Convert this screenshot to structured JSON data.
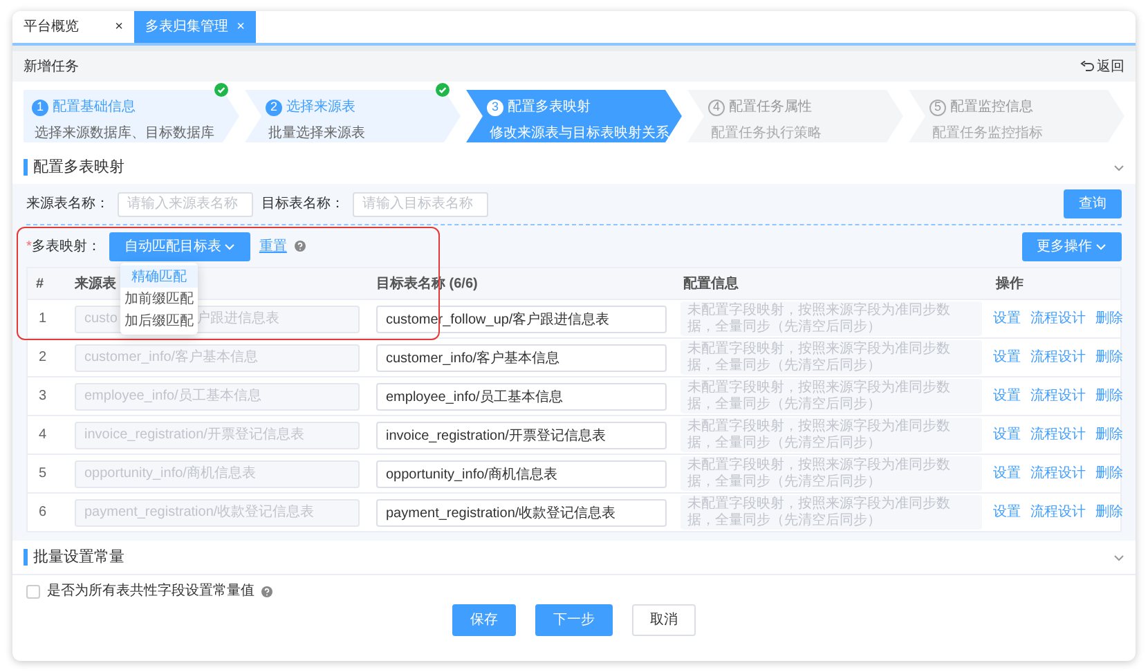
{
  "tabs": [
    {
      "label": "平台概览",
      "close": "×",
      "selected": false
    },
    {
      "label": "多表归集管理",
      "close": "×",
      "selected": true
    }
  ],
  "page": {
    "title": "新增任务",
    "back": "返回"
  },
  "steps": [
    {
      "number": "1",
      "title": "配置基础信息",
      "description": "选择来源数据库、目标数据库",
      "completed": true,
      "selected": false
    },
    {
      "number": "2",
      "title": "选择来源表",
      "description": "批量选择来源表",
      "completed": true,
      "selected": false
    },
    {
      "number": "3",
      "title": "配置多表映射",
      "description": "修改来源表与目标表映射关系",
      "completed": false,
      "selected": true
    },
    {
      "number": "4",
      "title": "配置任务属性",
      "description": "配置任务执行策略",
      "completed": false,
      "selected": false
    },
    {
      "number": "5",
      "title": "配置监控信息",
      "description": "配置任务监控指标",
      "completed": false,
      "selected": false
    }
  ],
  "mapping_section": {
    "title": "配置多表映射"
  },
  "filters": [
    {
      "label": "来源表名称：",
      "placeholder": "请输入来源表名称"
    },
    {
      "label": "目标表名称：",
      "placeholder": "请输入目标表名称"
    }
  ],
  "query_button": "查询",
  "mapping": {
    "required_mark": "*",
    "label": "多表映射：",
    "auto_button": "自动匹配目标表",
    "reset": "重置",
    "more_button": "更多操作",
    "menu": [
      {
        "label": "精确匹配",
        "selected": true
      },
      {
        "label": "加前缀匹配",
        "selected": false
      },
      {
        "label": "加后缀匹配",
        "selected": false
      }
    ]
  },
  "table": {
    "columns": [
      "#",
      "来源表",
      "目标表名称 (6/6)",
      "配置信息",
      "操作"
    ],
    "rows": [
      {
        "index": "1",
        "source": [
          "custo",
          "户跟进信息表"
        ],
        "target": "customer_follow_up/客户跟进信息表",
        "config_placeholder": "未配置字段映射，按照来源字段为准同步数据，全量同步（先清空后同步）",
        "actions": [
          "设置",
          "流程设计",
          "删除"
        ]
      },
      {
        "index": "2",
        "source": [
          "customer_info/客户基本信息"
        ],
        "target": "customer_info/客户基本信息",
        "config_placeholder": "未配置字段映射，按照来源字段为准同步数据，全量同步（先清空后同步）",
        "actions": [
          "设置",
          "流程设计",
          "删除"
        ]
      },
      {
        "index": "3",
        "source": [
          "employee_info/员工基本信息"
        ],
        "target": "employee_info/员工基本信息",
        "config_placeholder": "未配置字段映射，按照来源字段为准同步数据，全量同步（先清空后同步）",
        "actions": [
          "设置",
          "流程设计",
          "删除"
        ]
      },
      {
        "index": "4",
        "source": [
          "invoice_registration/开票登记信息表"
        ],
        "target": "invoice_registration/开票登记信息表",
        "config_placeholder": "未配置字段映射，按照来源字段为准同步数据，全量同步（先清空后同步）",
        "actions": [
          "设置",
          "流程设计",
          "删除"
        ]
      },
      {
        "index": "5",
        "source": [
          "opportunity_info/商机信息表"
        ],
        "target": "opportunity_info/商机信息表",
        "config_placeholder": "未配置字段映射，按照来源字段为准同步数据，全量同步（先清空后同步）",
        "actions": [
          "设置",
          "流程设计",
          "删除"
        ]
      },
      {
        "index": "6",
        "source": [
          "payment_registration/收款登记信息表"
        ],
        "target": "payment_registration/收款登记信息表",
        "config_placeholder": "未配置字段映射，按照来源字段为准同步数据，全量同步（先清空后同步）",
        "actions": [
          "设置",
          "流程设计",
          "删除"
        ]
      }
    ]
  },
  "constants_section": {
    "title": "批量设置常量"
  },
  "constant_option": {
    "label": "是否为所有表共性字段设置常量值",
    "checked": false
  },
  "buttons": [
    {
      "label": "保存",
      "kind": "primary"
    },
    {
      "label": "下一步",
      "kind": "primary"
    },
    {
      "label": "取消",
      "kind": "default"
    }
  ]
}
